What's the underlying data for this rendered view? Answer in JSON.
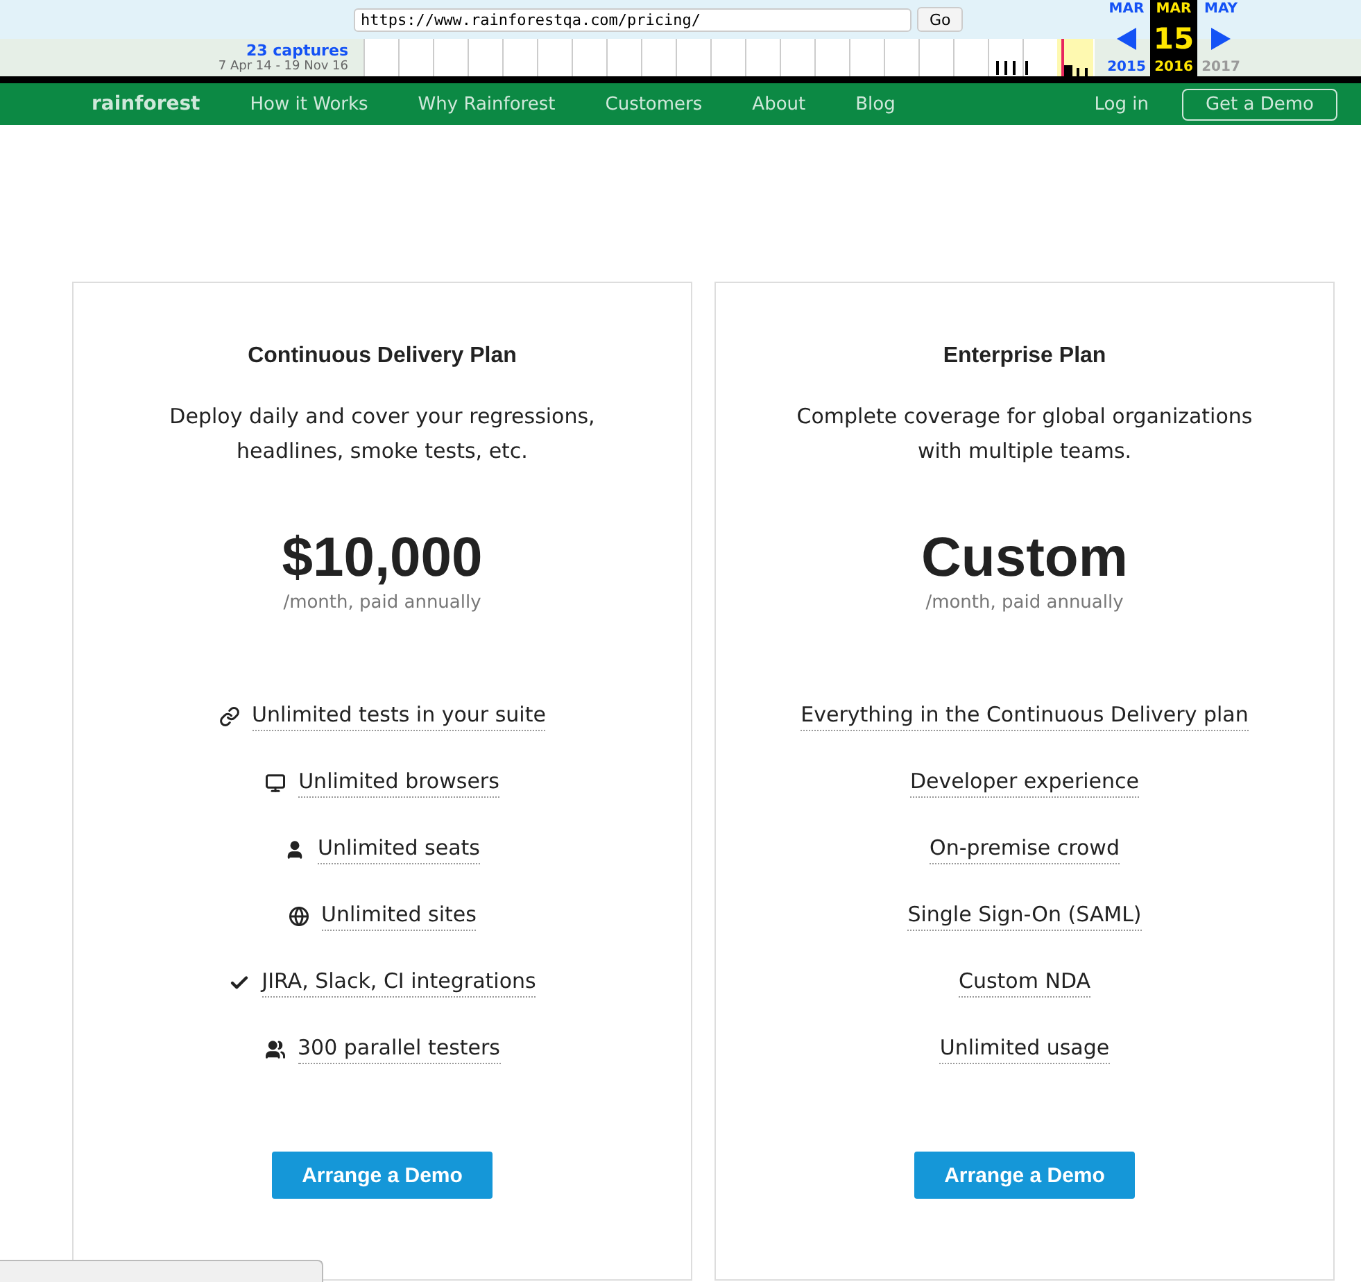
{
  "wayback": {
    "captures": "23 captures",
    "range": "7 Apr 14 - 19 Nov 16",
    "url": "https://www.rainforestqa.com/pricing/",
    "go": "Go",
    "months": [
      {
        "label": "MAR",
        "selected": false
      },
      {
        "label": "MAR",
        "selected": true
      },
      {
        "label": "MAY",
        "selected": false
      }
    ],
    "day": "15",
    "years": [
      {
        "label": "2015",
        "selected": false,
        "disabled": false
      },
      {
        "label": "2016",
        "selected": true,
        "disabled": false
      },
      {
        "label": "2017",
        "selected": false,
        "disabled": true
      }
    ]
  },
  "nav": {
    "logo": "rainforest",
    "links": [
      "How it Works",
      "Why Rainforest",
      "Customers",
      "About",
      "Blog"
    ],
    "login": "Log in",
    "cta": "Get a Demo"
  },
  "plans": [
    {
      "title": "Continuous Delivery Plan",
      "description": "Deploy daily and cover your regressions, headlines, smoke tests, etc.",
      "price": "$10,000",
      "period": "/month, paid annually",
      "features": [
        {
          "text": "Unlimited tests in your suite",
          "has_icon": true
        },
        {
          "text": "Unlimited browsers",
          "has_icon": true
        },
        {
          "text": "Unlimited seats",
          "has_icon": true
        },
        {
          "text": "Unlimited sites",
          "has_icon": true
        },
        {
          "text": "JIRA, Slack, CI integrations",
          "has_icon": true
        },
        {
          "text": "300 parallel testers",
          "has_icon": true
        }
      ],
      "button": "Arrange a Demo"
    },
    {
      "title": "Enterprise Plan",
      "description": "Complete coverage for global organizations with multiple teams.",
      "price": "Custom",
      "period": "/month, paid annually",
      "features": [
        {
          "text": "Everything in the Continuous Delivery plan",
          "has_icon": false
        },
        {
          "text": "Developer experience",
          "has_icon": false
        },
        {
          "text": "On-premise crowd",
          "has_icon": false
        },
        {
          "text": "Single Sign-On (SAML)",
          "has_icon": false
        },
        {
          "text": "Custom NDA",
          "has_icon": false
        },
        {
          "text": "Unlimited usage",
          "has_icon": false
        }
      ],
      "button": "Arrange a Demo"
    }
  ]
}
